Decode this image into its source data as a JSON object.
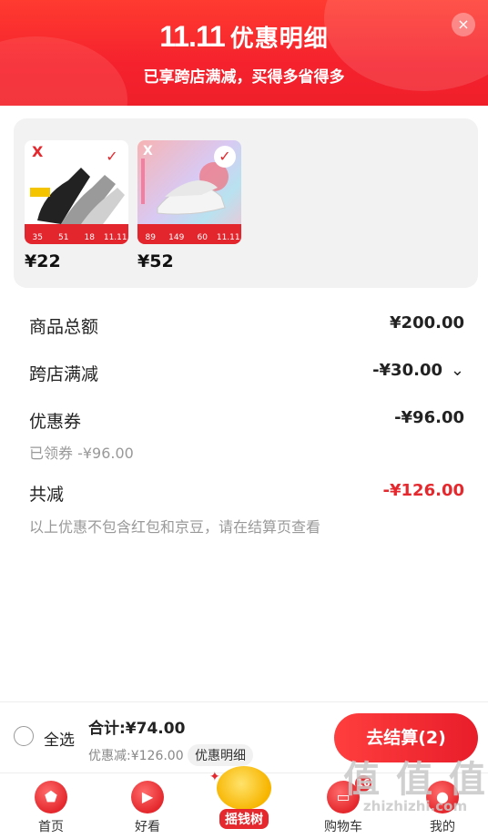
{
  "header": {
    "logo_text": "11.11",
    "title": "优惠明细",
    "subtitle": "已享跨店满减，买得多省得多",
    "close_glyph": "×"
  },
  "products": [
    {
      "price": "¥22",
      "image": "socks-product-image",
      "strip": [
        "35",
        "51",
        "18",
        "11.11"
      ]
    },
    {
      "price": "¥52",
      "image": "sneakers-product-image",
      "strip": [
        "89",
        "149",
        "60",
        "11.11"
      ]
    }
  ],
  "summary": {
    "total_label": "商品总额",
    "total_value": "¥200.00",
    "crossstore_label": "跨店满减",
    "crossstore_value": "-¥30.00",
    "coupon_label": "优惠券",
    "coupon_value": "-¥96.00",
    "coupon_note": "已领券 -¥96.00",
    "reduce_label": "共减",
    "reduce_value": "-¥126.00",
    "footnote": "以上优惠不包含红包和京豆，请在结算页查看"
  },
  "checkout": {
    "select_all": "全选",
    "total": "合计:¥74.00",
    "discount": "优惠减:¥126.00",
    "detail_button": "优惠明细",
    "pay_button": "去结算(2)"
  },
  "tabbar": {
    "home": "首页",
    "watch": "好看",
    "money_tree": "摇钱树",
    "cart": "购物车",
    "cart_badge": "16",
    "me": "我的"
  },
  "watermark": {
    "big": "值 值 值",
    "small": "zhizhizhi.com"
  },
  "colors": {
    "brand_red": "#e4282d",
    "header_red": "#f5222d",
    "gray_card": "#f2f2f2"
  }
}
